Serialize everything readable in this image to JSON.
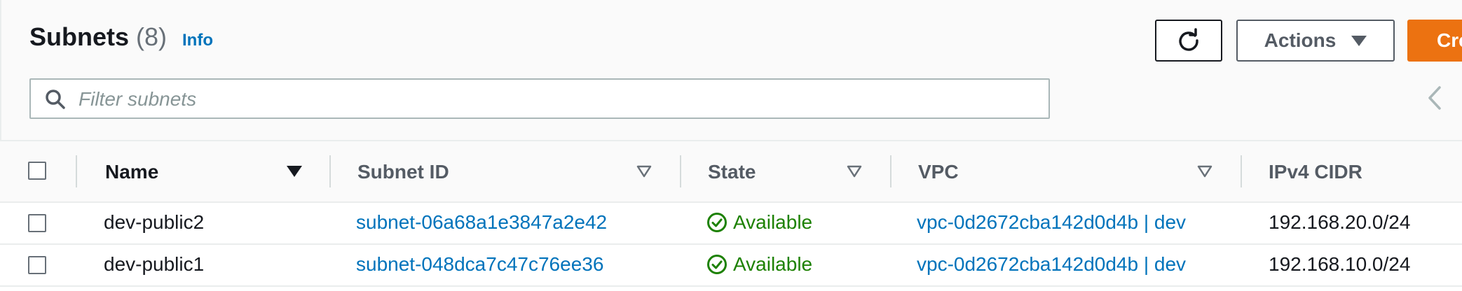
{
  "header": {
    "title": "Subnets",
    "count": "(8)",
    "info_link": "Info",
    "actions_label": "Actions",
    "create_label": "Cre"
  },
  "search": {
    "placeholder": "Filter subnets"
  },
  "table": {
    "columns": [
      "Name",
      "Subnet ID",
      "State",
      "VPC",
      "IPv4 CIDR"
    ],
    "rows": [
      {
        "name": "dev-public2",
        "subnet_id": "subnet-06a68a1e3847a2e42",
        "state": "Available",
        "vpc": "vpc-0d2672cba142d0d4b | dev",
        "ipv4_cidr": "192.168.20.0/24"
      },
      {
        "name": "dev-public1",
        "subnet_id": "subnet-048dca7c47c76ee36",
        "state": "Available",
        "vpc": "vpc-0d2672cba142d0d4b | dev",
        "ipv4_cidr": "192.168.10.0/24"
      }
    ]
  },
  "icons": {
    "refresh": "refresh-icon",
    "actions_caret": "caret-down-icon",
    "search": "search-icon",
    "collapse": "chevron-left-icon",
    "sort_active": "sort-descending-icon",
    "sort": "sort-icon",
    "status_ok": "check-circle-icon"
  },
  "colors": {
    "primary_button": "#ec7211",
    "link": "#0073bb",
    "status_available": "#1d8102",
    "header_background": "#fafafa"
  }
}
